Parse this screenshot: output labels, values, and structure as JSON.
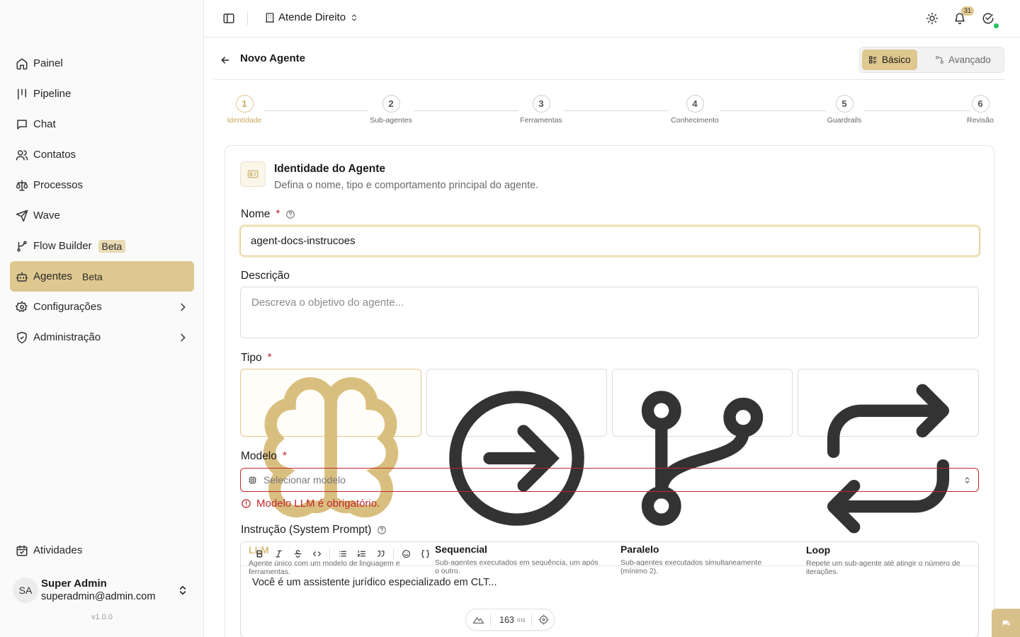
{
  "sidebar": {
    "items": [
      {
        "label": "Painel",
        "icon": "home-icon"
      },
      {
        "label": "Pipeline",
        "icon": "pipeline-icon"
      },
      {
        "label": "Chat",
        "icon": "chat-icon"
      },
      {
        "label": "Contatos",
        "icon": "users-icon"
      },
      {
        "label": "Processos",
        "icon": "scale-icon"
      },
      {
        "label": "Wave",
        "icon": "send-icon"
      },
      {
        "label": "Flow Builder",
        "icon": "flow-icon",
        "badge": "Beta"
      },
      {
        "label": "Agentes",
        "icon": "bot-icon",
        "badge": "Beta",
        "active": true
      },
      {
        "label": "Configurações",
        "icon": "gear-icon"
      },
      {
        "label": "Administração",
        "icon": "shield-icon"
      }
    ],
    "bottom": {
      "label": "Atividades"
    },
    "user": {
      "initials": "SA",
      "name": "Super Admin",
      "email": "superadmin@admin.com"
    },
    "version": "v1.0.0"
  },
  "topbar": {
    "organization": "Atende Direito",
    "notification_count": "31"
  },
  "page": {
    "title": "Novo Agente",
    "modes": {
      "basic": "Básico",
      "advanced": "Avançado",
      "active": "basic"
    }
  },
  "stepper": {
    "steps": [
      {
        "number": "1",
        "label": "Identidade"
      },
      {
        "number": "2",
        "label": "Sub-agentes"
      },
      {
        "number": "3",
        "label": "Ferramentas"
      },
      {
        "number": "4",
        "label": "Conhecimento"
      },
      {
        "number": "5",
        "label": "Guardrails"
      },
      {
        "number": "6",
        "label": "Revisão"
      }
    ],
    "current": 1
  },
  "form": {
    "title": "Identidade do Agente",
    "subtitle": "Defina o nome, tipo e comportamento principal do agente.",
    "name_label": "Nome",
    "name_value": "agent-docs-instrucoes",
    "required_mark": "*",
    "description_label": "Descrição",
    "description_placeholder": "Descreva o objetivo do agente...",
    "type_label": "Tipo",
    "types": [
      {
        "title": "LLM",
        "desc": "Agente único com um modelo de linguagem e ferramentas.",
        "selected": true
      },
      {
        "title": "Sequencial",
        "desc": "Sub-agentes executados em sequência, um após o outro."
      },
      {
        "title": "Paralelo",
        "desc": "Sub-agentes executados simultaneamente (mínimo 2)."
      },
      {
        "title": "Loop",
        "desc": "Repete um sub-agente até atingir o número de iterações."
      }
    ],
    "model_label": "Modelo",
    "model_placeholder": "Selecionar modelo",
    "model_error": "Modelo LLM é obrigatório.",
    "instruction_label": "Instrução (System Prompt)",
    "instruction_value": "Você é um assistente jurídico especializado em CLT..."
  },
  "perf": {
    "value": "163",
    "unit": "ms"
  },
  "colors": {
    "accent": "#dfc88f",
    "error": "#c0272d",
    "online": "#22c55e"
  }
}
